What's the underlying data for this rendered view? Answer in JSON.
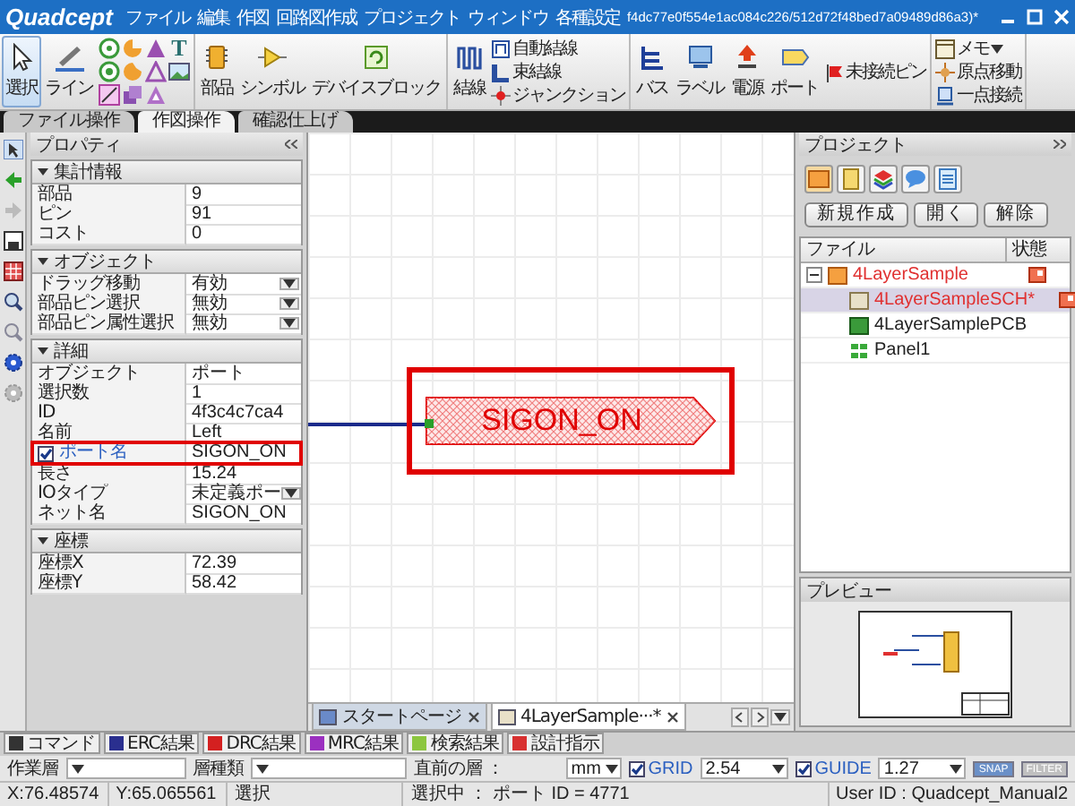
{
  "title_bar": {
    "logo": "Quadcept",
    "menus": [
      "ファイル",
      "編集",
      "作図",
      "回路図作成",
      "プロジェクト",
      "ウィンドウ",
      "各種設定"
    ],
    "title": "f4dc77e0f554e1ac084c226/512d72f48bed7a09489d86a3)*"
  },
  "ribbon": {
    "groups": [
      [
        {
          "kind": "large",
          "label": "選択",
          "selected": true
        },
        {
          "kind": "large",
          "label": "ライン",
          "selected": false
        },
        {
          "kind": "shapes",
          "text_tool": "T"
        }
      ],
      [
        {
          "kind": "large",
          "label": "部品",
          "selected": false
        },
        {
          "kind": "large",
          "label": "シンボル",
          "selected": false
        },
        {
          "kind": "large",
          "label": "デバイスブロック",
          "selected": false
        }
      ],
      [
        {
          "kind": "large",
          "label": "結線",
          "selected": false
        },
        {
          "kind": "stack",
          "items": [
            {
              "label": "自動結線",
              "dropdown": false
            },
            {
              "label": "束結線",
              "dropdown": false
            },
            {
              "label": "ジャンクション",
              "dropdown": false
            }
          ]
        }
      ],
      [
        {
          "kind": "large",
          "label": "バス",
          "selected": false
        },
        {
          "kind": "large",
          "label": "ラベル",
          "selected": false
        },
        {
          "kind": "large",
          "label": "電源",
          "selected": false
        },
        {
          "kind": "large",
          "label": "ポート",
          "selected": false
        },
        {
          "kind": "stack",
          "items": [
            {
              "label": "未接続ピン",
              "dropdown": false
            }
          ]
        }
      ],
      [
        {
          "kind": "stack",
          "items": [
            {
              "label": "メモ",
              "dropdown": true
            },
            {
              "label": "原点移動",
              "dropdown": false
            },
            {
              "label": "一点接続",
              "dropdown": false
            }
          ]
        }
      ]
    ]
  },
  "mode_tabs": [
    {
      "label": "ファイル操作",
      "selected": false
    },
    {
      "label": "作図操作",
      "selected": true
    },
    {
      "label": "確認仕上げ",
      "selected": false
    }
  ],
  "properties": {
    "title": "プロパティ",
    "sections": [
      {
        "title": "集計情報",
        "expanded": true,
        "rows": [
          {
            "kind": "text",
            "label": "部品",
            "value": "9"
          },
          {
            "kind": "text",
            "label": "ピン",
            "value": "91"
          },
          {
            "kind": "text",
            "label": "コスト",
            "value": "0"
          }
        ]
      },
      {
        "title": "オブジェクト",
        "expanded": true,
        "rows": [
          {
            "kind": "select",
            "label": "ドラッグ移動",
            "value": "有効"
          },
          {
            "kind": "select",
            "label": "部品ピン選択",
            "value": "無効"
          },
          {
            "kind": "select",
            "label": "部品ピン属性選択",
            "value": "無効"
          }
        ]
      },
      {
        "title": "詳細",
        "expanded": true,
        "rows": [
          {
            "kind": "text",
            "label": "オブジェクト",
            "value": "ポート"
          },
          {
            "kind": "text",
            "label": "選択数",
            "value": "1"
          },
          {
            "kind": "text",
            "label": "ID",
            "value": "4f3c4c7ca4"
          },
          {
            "kind": "text",
            "label": "名前",
            "value": "Left"
          },
          {
            "kind": "checkbox",
            "label": "ポート名",
            "value": "SIGON_ON",
            "checked": true,
            "highlighted": true
          },
          {
            "kind": "text",
            "label": "長さ",
            "value": "15.24"
          },
          {
            "kind": "select",
            "label": "IOタイプ",
            "value": "未定義ポー"
          },
          {
            "kind": "text",
            "label": "ネット名",
            "value": "SIGON_ON"
          }
        ]
      },
      {
        "title": "座標",
        "expanded": true,
        "rows": [
          {
            "kind": "text",
            "label": "座標X",
            "value": "72.39"
          },
          {
            "kind": "text",
            "label": "座標Y",
            "value": "58.42"
          }
        ]
      }
    ]
  },
  "canvas": {
    "port": {
      "label": "SIGON_ON",
      "highlighted": true
    },
    "doc_tabs": [
      {
        "label": "スタートページ",
        "selected": false
      },
      {
        "label": "4LayerSample···*",
        "selected": true
      }
    ]
  },
  "project": {
    "title": "プロジェクト",
    "buttons": [
      "新規作成",
      "開く",
      "解除"
    ],
    "columns": [
      "ファイル",
      "状態"
    ],
    "items": [
      {
        "label": "4LayerSample",
        "kind": "project",
        "modified": true,
        "selected": false,
        "expanded": true,
        "children": [
          {
            "label": "4LayerSampleSCH*",
            "kind": "schematic",
            "modified": true,
            "selected": true
          },
          {
            "label": "4LayerSamplePCB",
            "kind": "pcb",
            "modified": false,
            "selected": false
          },
          {
            "label": "Panel1",
            "kind": "panel",
            "modified": false,
            "selected": false
          }
        ]
      }
    ]
  },
  "preview": {
    "title": "プレビュー"
  },
  "bottom_tabs": [
    {
      "label": "コマンド",
      "color": "#333333"
    },
    {
      "label": "ERC結果",
      "color": "#2a2f8f"
    },
    {
      "label": "DRC結果",
      "color": "#d42020"
    },
    {
      "label": "MRC結果",
      "color": "#9b30c0"
    },
    {
      "label": "検索結果",
      "color": "#8cc63f"
    },
    {
      "label": "設計指示",
      "color": "#d83030"
    }
  ],
  "layer_bar": {
    "work_layer": "作業層",
    "layer_type": "層種類",
    "previous_layer": "直前の層 ：",
    "unit": "mm",
    "grid": {
      "label": "GRID",
      "checked": true,
      "value": "2.54"
    },
    "guide": {
      "label": "GUIDE",
      "checked": true,
      "value": "1.27"
    },
    "snap": "SNAP",
    "filter": "FILTER"
  },
  "status_bar": {
    "x": "X:76.48574",
    "y": "Y:65.065561",
    "mode": "選択",
    "selection": "選択中 ： ポート ID = 4771",
    "user": "User ID : Quadcept_Manual2"
  }
}
